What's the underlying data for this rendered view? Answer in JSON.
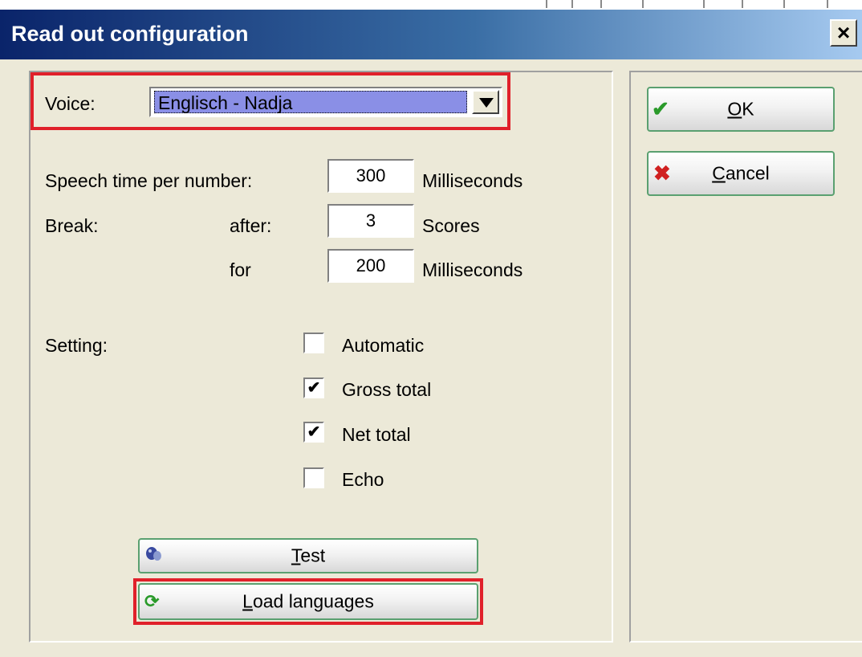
{
  "window": {
    "title": "Read out configuration",
    "close_label": "×"
  },
  "voice": {
    "label": "Voice:",
    "selected": "Englisch - Nadja"
  },
  "speech_time": {
    "label": "Speech time per number:",
    "value": "300",
    "unit": "Milliseconds"
  },
  "break": {
    "label": "Break:",
    "after_label": "after:",
    "after_value": "3",
    "after_unit": "Scores",
    "for_label": "for",
    "for_value": "200",
    "for_unit": "Milliseconds"
  },
  "setting": {
    "label": "Setting:",
    "options": [
      {
        "label": "Automatic",
        "checked": false
      },
      {
        "label": "Gross total",
        "checked": true
      },
      {
        "label": "Net total",
        "checked": true
      },
      {
        "label": "Echo",
        "checked": false
      }
    ]
  },
  "buttons": {
    "test_first": "T",
    "test_rest": "est",
    "load_first": "L",
    "load_rest": "oad languages",
    "ok_first": "O",
    "ok_rest": "K",
    "cancel_first": "C",
    "cancel_rest": "ancel"
  },
  "icons": {
    "ok": "checkmark-icon",
    "cancel": "x-icon",
    "test": "speaker-icon",
    "load": "refresh-icon"
  },
  "colors": {
    "highlight_border": "#e0202a",
    "button_border": "#5aa070",
    "selection_bg": "#8a8fe6"
  }
}
